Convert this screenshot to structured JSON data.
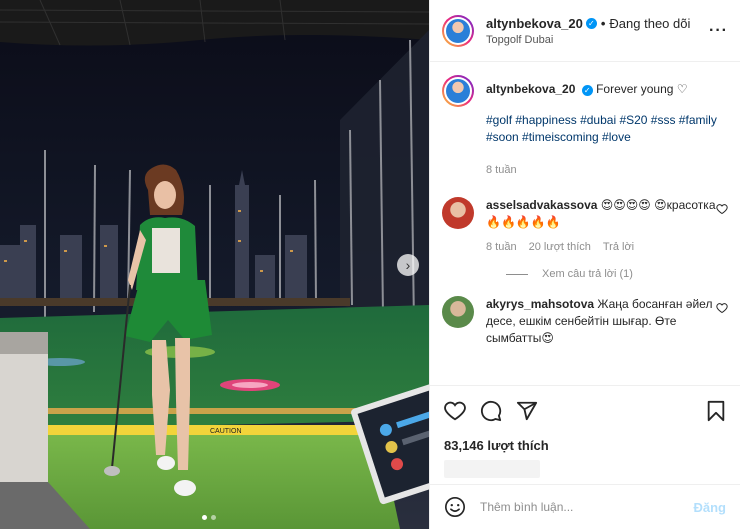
{
  "post": {
    "username": "altynbekova_20",
    "separator": "•",
    "follow_status": "Đang theo dõi",
    "location": "Topgolf Dubai",
    "more_icon": "more-horizontal-icon",
    "colors": {
      "link": "#00376b",
      "verified": "#0095f6",
      "post_button_disabled": "#b3dffc"
    }
  },
  "caption": {
    "username": "altynbekova_20",
    "text": "Forever young",
    "emoji": "♡",
    "hashtags": "#golf #happiness #dubai #S20 #sss #family #soon #timeiscoming #love",
    "time": "8 tuần"
  },
  "comments": [
    {
      "username": "asselsadvakassova",
      "text": "😍😍😍😍 😍красотка🔥🔥🔥🔥🔥",
      "time": "8 tuần",
      "likes": "20 lượt thích",
      "reply": "Trả lời",
      "view_replies": "Xem câu trả lời (1)"
    },
    {
      "username": "akyrys_mahsotova",
      "text": "Жаңа босанған әйел десе, ешкім сенбейтін шығар. Өте сымбатты😍"
    }
  ],
  "actions": {
    "like_icon": "heart-icon",
    "comment_icon": "comment-icon",
    "share_icon": "share-icon",
    "save_icon": "bookmark-icon"
  },
  "likes": "83,146 lượt thích",
  "composer": {
    "emoji_icon": "emoji-icon",
    "placeholder": "Thêm bình luận...",
    "post_label": "Đăng"
  },
  "media": {
    "carousel_next": "›",
    "sign_text": "CAUTION",
    "slides": 2,
    "active_slide": 1
  }
}
